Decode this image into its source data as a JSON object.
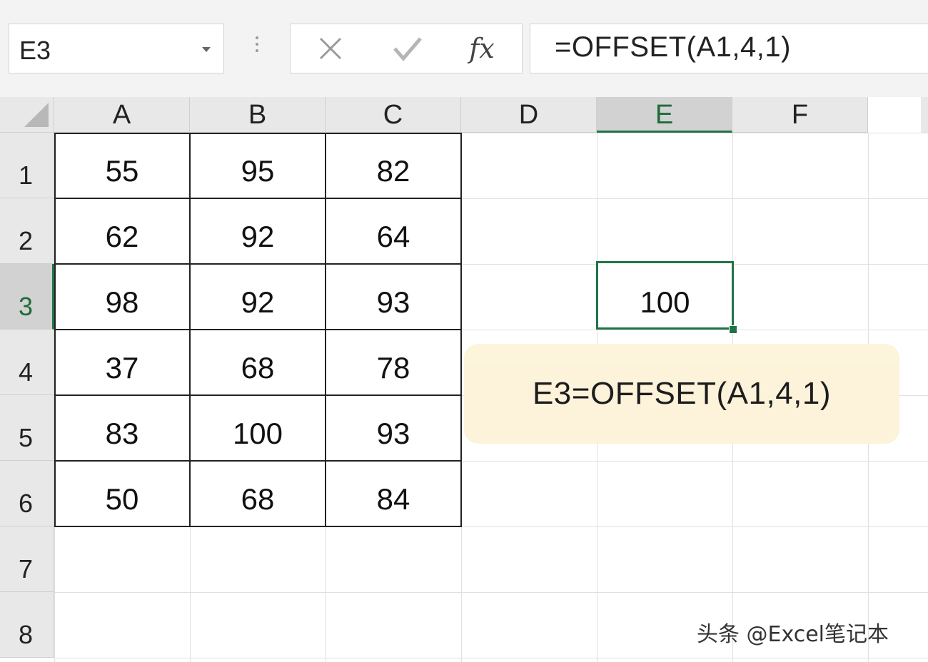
{
  "formula_bar": {
    "name_box": "E3",
    "cancel_icon": "close-icon",
    "enter_icon": "check-icon",
    "fx_label": "fx",
    "formula": "=OFFSET(A1,4,1)"
  },
  "grid": {
    "columns": [
      "A",
      "B",
      "C",
      "D",
      "E",
      "F"
    ],
    "selected_column": "E",
    "rows": [
      "1",
      "2",
      "3",
      "4",
      "5",
      "6",
      "7",
      "8"
    ],
    "selected_row": "3",
    "values": [
      [
        "55",
        "95",
        "82"
      ],
      [
        "62",
        "92",
        "64"
      ],
      [
        "98",
        "92",
        "93"
      ],
      [
        "37",
        "68",
        "78"
      ],
      [
        "83",
        "100",
        "93"
      ],
      [
        "50",
        "68",
        "84"
      ]
    ],
    "active_cell": {
      "ref": "E3",
      "value": "100"
    }
  },
  "annotation": "E3=OFFSET(A1,4,1)",
  "watermark": "头条 @Excel笔记本",
  "colors": {
    "accent": "#217346",
    "note_bg": "#fdf3da"
  }
}
